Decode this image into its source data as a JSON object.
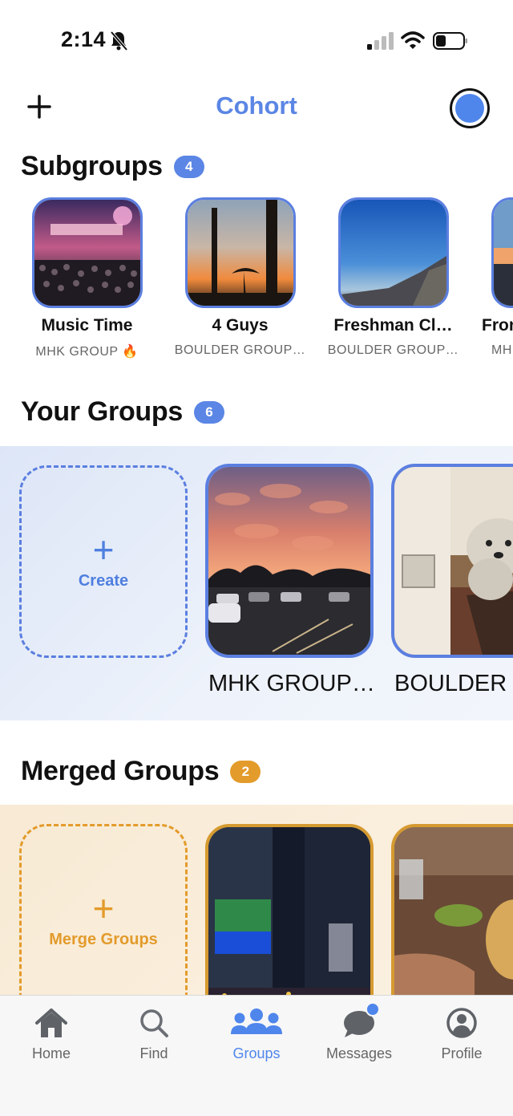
{
  "status_bar": {
    "time": "2:14",
    "accent": "#111111"
  },
  "header": {
    "title": "Cohort",
    "title_color": "#5b86e5",
    "add_icon": "plus-icon",
    "profile_icon": "avatar-icon"
  },
  "subgroups": {
    "title": "Subgroups",
    "count": "4",
    "badge_color": "#5b86e5",
    "items": [
      {
        "name": "Music Time",
        "group": "MHK GROUP 🔥"
      },
      {
        "name": "4 Guys",
        "group": "BOULDER GROUP…"
      },
      {
        "name": "Freshman Cl…",
        "group": "BOULDER GROUP…"
      },
      {
        "name": "Fron",
        "group": "MH"
      }
    ]
  },
  "your_groups": {
    "title": "Your Groups",
    "count": "6",
    "badge_color": "#5b86e5",
    "create_label": "Create",
    "create_icon": "plus-icon",
    "items": [
      {
        "name": "MHK GROUP…"
      },
      {
        "name": "BOULDER"
      }
    ]
  },
  "merged_groups": {
    "title": "Merged Groups",
    "count": "2",
    "badge_color": "#e39b2b",
    "create_label": "Merge Groups",
    "create_icon": "plus-icon"
  },
  "tabs": [
    {
      "label": "Home",
      "icon": "home-icon"
    },
    {
      "label": "Find",
      "icon": "search-icon"
    },
    {
      "label": "Groups",
      "icon": "groups-icon",
      "active": true
    },
    {
      "label": "Messages",
      "icon": "messages-icon"
    },
    {
      "label": "Profile",
      "icon": "profile-icon"
    }
  ]
}
